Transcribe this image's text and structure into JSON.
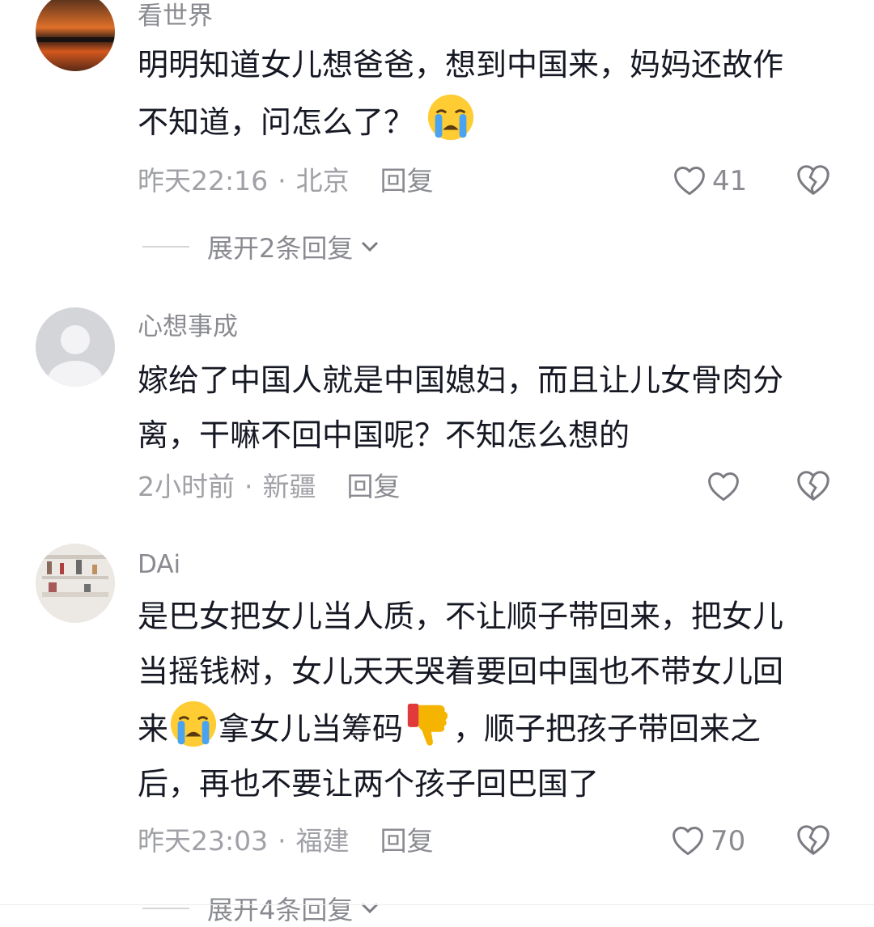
{
  "comments": [
    {
      "username": "看世界",
      "lines": [
        "明明知道女儿想爸爸，想到中国来，妈妈还故作",
        "不知道，问怎么了？"
      ],
      "time": "昨天22:16",
      "location": "北京",
      "reply_label": "回复",
      "likes": "41",
      "expand_label": "展开2条回复"
    },
    {
      "username": "心想事成",
      "lines": [
        "嫁给了中国人就是中国媳妇，而且让儿女骨肉分",
        "离，干嘛不回中国呢？不知怎么想的"
      ],
      "time": "2小时前",
      "location": "新疆",
      "reply_label": "回复",
      "likes": ""
    },
    {
      "username": "DAi",
      "line1": "是巴女把女儿当人质，不让顺子带回来，把女儿",
      "line2": "当摇钱树，女儿天天哭着要回中国也不带女儿回",
      "line3_a": "来",
      "line3_b": "拿女儿当筹码",
      "line3_c": "，顺子把孩子带回来之",
      "line4": "后，再也不要让两个孩子回巴国了",
      "time": "昨天23:03",
      "location": "福建",
      "reply_label": "回复",
      "likes": "70",
      "expand_label": "展开4条回复"
    }
  ],
  "separator": "·",
  "colors": {
    "text": "#161823",
    "secondary": "#8a8b91",
    "meta": "#a0a1a6",
    "emoji_face": "#ffcc33",
    "emoji_tear": "#4aa3f0"
  },
  "icons": [
    "crying-emoji-icon",
    "thumbs-down-emoji-icon",
    "heart-icon",
    "broken-heart-icon",
    "chevron-down-icon"
  ]
}
